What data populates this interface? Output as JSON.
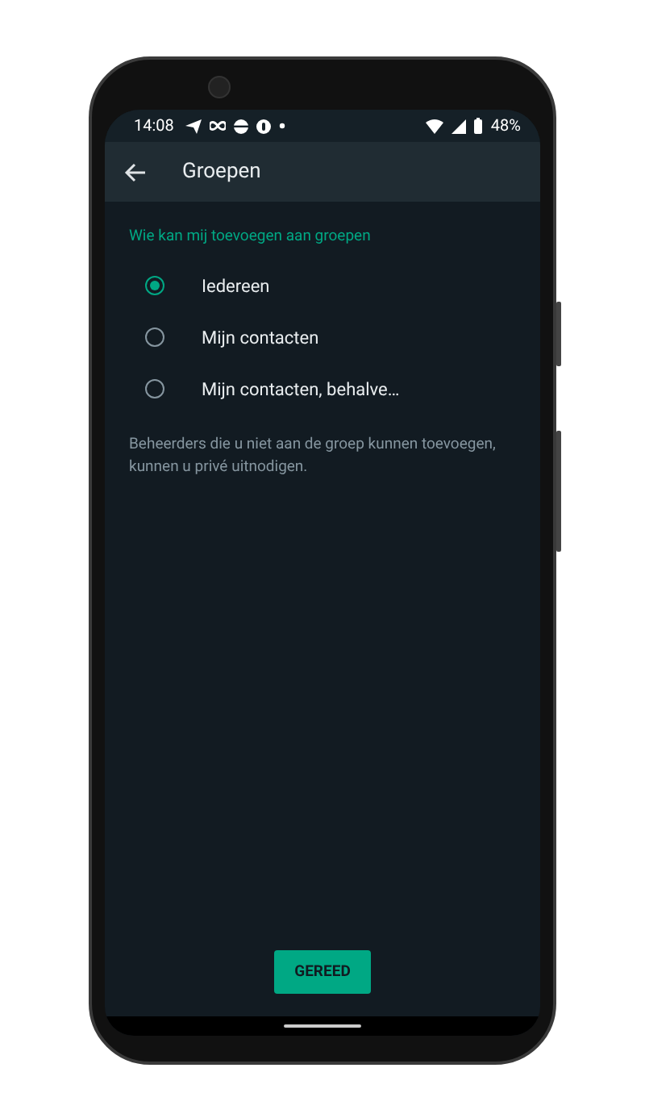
{
  "status_bar": {
    "time": "14:08",
    "battery": "48%"
  },
  "app_bar": {
    "title": "Groepen"
  },
  "section": {
    "heading": "Wie kan mij toevoegen aan groepen"
  },
  "options": [
    {
      "label": "Iedereen",
      "selected": true
    },
    {
      "label": "Mijn contacten",
      "selected": false
    },
    {
      "label": "Mijn contacten, behalve…",
      "selected": false
    }
  ],
  "note": "Beheerders die u niet aan de groep kunnen toevoegen, kunnen u privé uitnodigen.",
  "button": "GEREED"
}
